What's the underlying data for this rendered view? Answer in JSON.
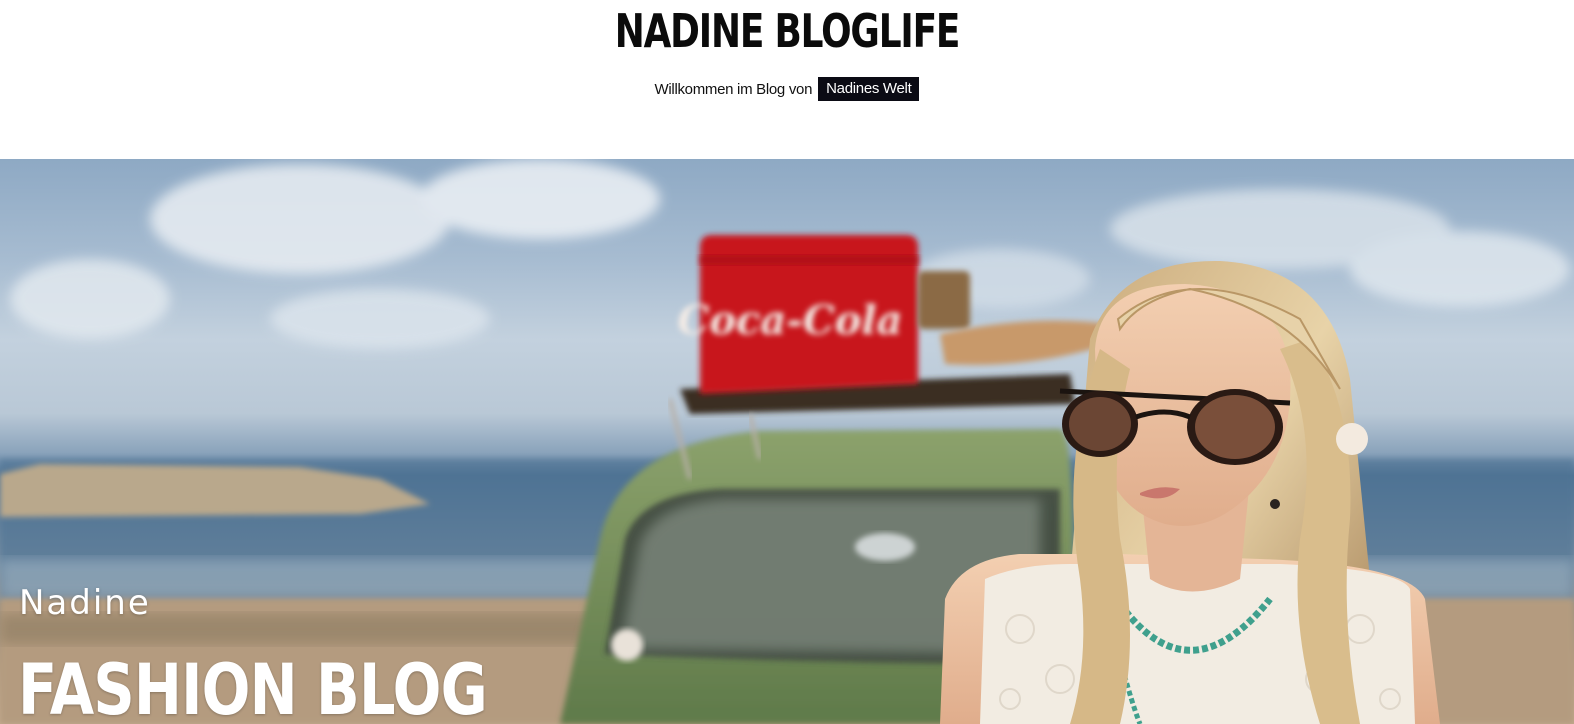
{
  "header": {
    "site_title": "NADINE BLOGLIFE",
    "tagline_text": "Willkommen im Blog von",
    "tagline_link": "Nadines Welt"
  },
  "hero": {
    "kicker": "Nadine",
    "title": "FASHION BLOG",
    "cooler_logo_text": "Coca-Cola",
    "image_description_icon": "hero-photo"
  },
  "colors": {
    "text_dark": "#0b0b0b",
    "link_bg": "#0b0b14",
    "link_text": "#ffffff",
    "hero_text": "#ffffff",
    "cooler_red": "#c8141e",
    "car_green": "#7a9460"
  }
}
